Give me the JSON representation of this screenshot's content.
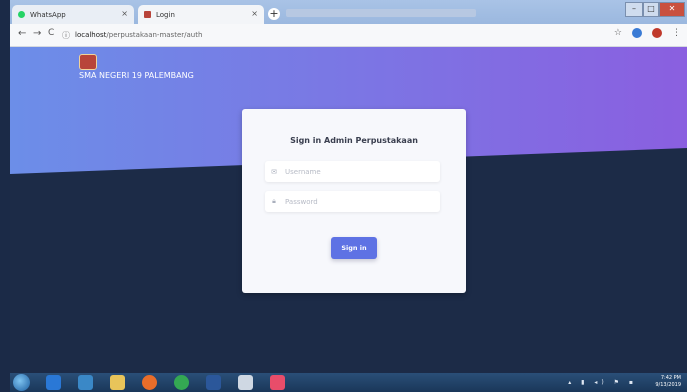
{
  "browser": {
    "tabs": [
      {
        "label": "WhatsApp",
        "close": "×",
        "color": "#25d366"
      },
      {
        "label": "Login",
        "close": "×"
      }
    ],
    "new_tab": "+",
    "url_host": "localhost",
    "url_path": "/perpustakaan-master/auth",
    "nav": {
      "back": "←",
      "forward": "→",
      "reload": "C",
      "info": "ⓘ"
    },
    "bookmark_star": "☆",
    "window_buttons": {
      "minimize": "–",
      "maximize": "□",
      "close": "✕"
    }
  },
  "page": {
    "school_name": "SMA NEGERI 19 PALEMBANG",
    "colors": {
      "gradient_start": "#6c8ee8",
      "gradient_end": "#8a5fe0",
      "dark": "#1c2b47",
      "button": "#5e72e4"
    },
    "login": {
      "title": "Sign in Admin Perpustakaan",
      "username_placeholder": "Username",
      "password_placeholder": "Password",
      "submit_label": "Sign in"
    }
  },
  "taskbar": {
    "time": "7:42 PM",
    "date": "9/13/2019"
  }
}
